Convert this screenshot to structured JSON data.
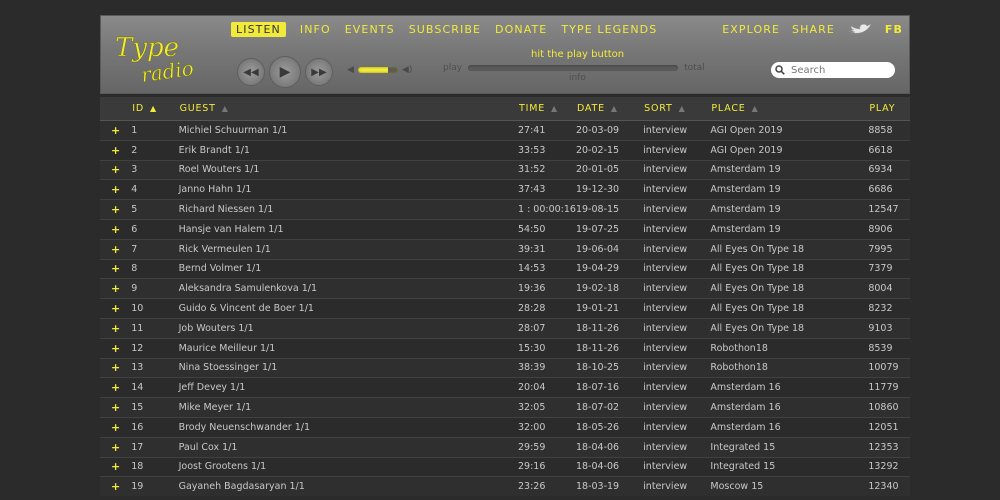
{
  "nav": {
    "listen": "LISTEN",
    "info": "INFO",
    "events": "EVENTS",
    "subscribe": "SUBSCRIBE",
    "donate": "DONATE",
    "type_legends": "TYPE LEGENDS",
    "explore": "EXPLORE",
    "share": "SHARE",
    "fb": "FB"
  },
  "player": {
    "now_playing": "hit the play button",
    "play_label": "play",
    "total_label": "total",
    "info_label": "info",
    "volume_level": 0.75
  },
  "search": {
    "placeholder": "Search"
  },
  "colors": {
    "accent": "#f2ea3a",
    "background": "#2b2b2b"
  },
  "table": {
    "columns": [
      "ID",
      "GUEST",
      "TIME",
      "DATE",
      "SORT",
      "PLACE",
      "PLAY"
    ],
    "rows": [
      {
        "id": "1",
        "guest": "Michiel Schuurman 1/1",
        "time": "27:41",
        "date": "20-03-09",
        "sort": "interview",
        "place": "AGI Open 2019",
        "play": "8858"
      },
      {
        "id": "2",
        "guest": "Erik Brandt 1/1",
        "time": "33:53",
        "date": "20-02-15",
        "sort": "interview",
        "place": "AGI Open 2019",
        "play": "6618"
      },
      {
        "id": "3",
        "guest": "Roel Wouters 1/1",
        "time": "31:52",
        "date": "20-01-05",
        "sort": "interview",
        "place": "Amsterdam 19",
        "play": "6934"
      },
      {
        "id": "4",
        "guest": "Janno Hahn 1/1",
        "time": "37:43",
        "date": "19-12-30",
        "sort": "interview",
        "place": "Amsterdam 19",
        "play": "6686"
      },
      {
        "id": "5",
        "guest": "Richard Niessen 1/1",
        "time": "1 : 00:00:16",
        "date": "19-08-15",
        "sort": "interview",
        "place": "Amsterdam 19",
        "play": "12547"
      },
      {
        "id": "6",
        "guest": "Hansje van Halem 1/1",
        "time": "54:50",
        "date": "19-07-25",
        "sort": "interview",
        "place": "Amsterdam 19",
        "play": "8906"
      },
      {
        "id": "7",
        "guest": "Rick Vermeulen 1/1",
        "time": "39:31",
        "date": "19-06-04",
        "sort": "interview",
        "place": "All Eyes On Type 18",
        "play": "7995"
      },
      {
        "id": "8",
        "guest": "Bernd Volmer 1/1",
        "time": "14:53",
        "date": "19-04-29",
        "sort": "interview",
        "place": "All Eyes On Type 18",
        "play": "7379"
      },
      {
        "id": "9",
        "guest": "Aleksandra Samulenkova 1/1",
        "time": "19:36",
        "date": "19-02-18",
        "sort": "interview",
        "place": "All Eyes On Type 18",
        "play": "8004"
      },
      {
        "id": "10",
        "guest": "Guido & Vincent de Boer 1/1",
        "time": "28:28",
        "date": "19-01-21",
        "sort": "interview",
        "place": "All Eyes On Type 18",
        "play": "8232"
      },
      {
        "id": "11",
        "guest": "Job Wouters 1/1",
        "time": "28:07",
        "date": "18-11-26",
        "sort": "interview",
        "place": "All Eyes On Type 18",
        "play": "9103"
      },
      {
        "id": "12",
        "guest": "Maurice Meilleur 1/1",
        "time": "15:30",
        "date": "18-11-26",
        "sort": "interview",
        "place": "Robothon18",
        "play": "8539"
      },
      {
        "id": "13",
        "guest": "Nina Stoessinger 1/1",
        "time": "38:39",
        "date": "18-10-25",
        "sort": "interview",
        "place": "Robothon18",
        "play": "10079"
      },
      {
        "id": "14",
        "guest": "Jeff Devey 1/1",
        "time": "20:04",
        "date": "18-07-16",
        "sort": "interview",
        "place": "Amsterdam 16",
        "play": "11779"
      },
      {
        "id": "15",
        "guest": "Mike Meyer 1/1",
        "time": "32:05",
        "date": "18-07-02",
        "sort": "interview",
        "place": "Amsterdam 16",
        "play": "10860"
      },
      {
        "id": "16",
        "guest": "Brody Neuenschwander 1/1",
        "time": "32:00",
        "date": "18-05-26",
        "sort": "interview",
        "place": "Amsterdam 16",
        "play": "12051"
      },
      {
        "id": "17",
        "guest": "Paul Cox 1/1",
        "time": "29:59",
        "date": "18-04-06",
        "sort": "interview",
        "place": "Integrated 15",
        "play": "12353"
      },
      {
        "id": "18",
        "guest": "Joost Grootens 1/1",
        "time": "29:16",
        "date": "18-04-06",
        "sort": "interview",
        "place": "Integrated 15",
        "play": "13292"
      },
      {
        "id": "19",
        "guest": "Gayaneh Bagdasaryan 1/1",
        "time": "23:26",
        "date": "18-03-19",
        "sort": "interview",
        "place": "Moscow 15",
        "play": "12340"
      }
    ]
  }
}
